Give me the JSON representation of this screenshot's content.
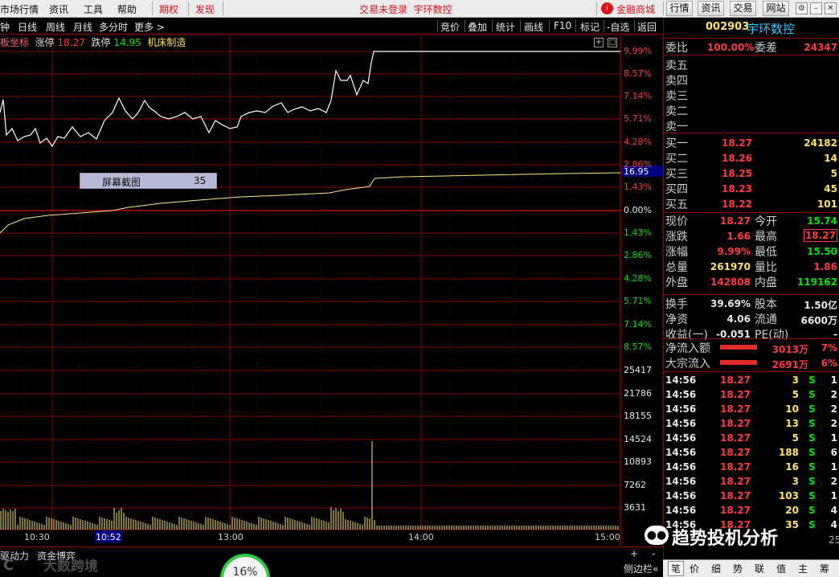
{
  "menubar": {
    "items": [
      "市场行情",
      "资讯",
      "工具",
      "帮助"
    ],
    "qiquan": "期权",
    "faxian": "发现",
    "status": "交易未登录",
    "stock_title": "宇环数控",
    "mall": "金融商城",
    "buttons": [
      "行情",
      "资讯",
      "交易",
      "网站"
    ]
  },
  "chart_toolbar": {
    "left": [
      "钟",
      "日线",
      "周线",
      "月线",
      "多分时",
      "更多"
    ],
    "more_arrow": ">",
    "right": [
      "竞价",
      "叠加",
      "统计",
      "画线",
      "F10",
      "标记",
      "-自选",
      "返回"
    ]
  },
  "info_line": {
    "label": "板坐标",
    "zt_label": "涨停",
    "zt_val": "18.27",
    "dt_label": "跌停",
    "dt_val": "14.95",
    "industry": "机床制造"
  },
  "price_axis": {
    "pct_labels_up": [
      "9.99%",
      "8.57%",
      "7.14%",
      "5.71%",
      "4.28%",
      "2.86%",
      "1.43%"
    ],
    "zero_label": "0.00%",
    "pct_labels_down": [
      "1.43%",
      "2.86%",
      "4.28%",
      "5.71%",
      "7.14%",
      "8.57%"
    ],
    "current_marker": "16.95",
    "vol_labels": [
      "25417",
      "21786",
      "18155",
      "14524",
      "10893",
      "7262",
      "3631"
    ]
  },
  "time_axis": {
    "labels": [
      "10:30",
      "13:00",
      "14:00",
      "15:00"
    ],
    "cursor": "10:52"
  },
  "popup": {
    "label": "屏幕截图",
    "value": "35"
  },
  "bottom_bar": {
    "tab1": "驱动力",
    "tab2": "资金博弈",
    "watermark": "大数跨境",
    "progress_text": "16%",
    "progress": 0.16,
    "plus": "+",
    "minus": "-",
    "side": "侧边栏",
    "side_arrow": "«"
  },
  "right_panel": {
    "code": "002903",
    "name": "宇环数控",
    "weibi_label": "委比",
    "weibi_val": "100.00%",
    "weicha_label": "委差",
    "weicha_val": "24347",
    "sell_labels": [
      "卖五",
      "卖四",
      "卖三",
      "卖二",
      "卖一"
    ],
    "buy_rows": [
      {
        "label": "买一",
        "price": "18.27",
        "vol": "24182"
      },
      {
        "label": "买二",
        "price": "18.26",
        "vol": "14"
      },
      {
        "label": "买三",
        "price": "18.25",
        "vol": "5"
      },
      {
        "label": "买四",
        "price": "18.23",
        "vol": "45"
      },
      {
        "label": "买五",
        "price": "18.22",
        "vol": "101"
      }
    ],
    "quote": [
      {
        "l1": "现价",
        "v1": "18.27",
        "c1": "red",
        "l2": "今开",
        "v2": "15.74",
        "c2": "green"
      },
      {
        "l1": "涨跌",
        "v1": "1.66",
        "c1": "red",
        "l2": "最高",
        "v2": "18.27",
        "c2": "red"
      },
      {
        "l1": "涨幅",
        "v1": "9.99%",
        "c1": "red",
        "l2": "最低",
        "v2": "15.50",
        "c2": "green"
      },
      {
        "l1": "总量",
        "v1": "261970",
        "c1": "yellow",
        "l2": "量比",
        "v2": "1.86",
        "c2": "red"
      },
      {
        "l1": "外盘",
        "v1": "142808",
        "c1": "red",
        "l2": "内盘",
        "v2": "119162",
        "c2": "green"
      }
    ],
    "fund": [
      {
        "l1": "换手",
        "v1": "39.69%",
        "l2": "股本",
        "v2": "1.50亿"
      },
      {
        "l1": "净资",
        "v1": "4.06",
        "l2": "流通",
        "v2": "6600万"
      },
      {
        "l1": "收益(一)",
        "v1": "-0.051",
        "l2": "PE(动)",
        "v2": "-"
      }
    ],
    "flow": [
      {
        "label": "净流入额",
        "val": "3013万",
        "pct": "7%"
      },
      {
        "label": "大宗流入",
        "val": "2691万",
        "pct": "6%"
      }
    ],
    "ticks": [
      {
        "time": "14:56",
        "price": "18.27",
        "vol": "3",
        "bs": "S",
        "extra": "1"
      },
      {
        "time": "14:56",
        "price": "18.27",
        "vol": "5",
        "bs": "S",
        "extra": "2"
      },
      {
        "time": "14:56",
        "price": "18.27",
        "vol": "10",
        "bs": "S",
        "extra": "2"
      },
      {
        "time": "14:56",
        "price": "18.27",
        "vol": "13",
        "bs": "S",
        "extra": "2"
      },
      {
        "time": "14:56",
        "price": "18.27",
        "vol": "5",
        "bs": "S",
        "extra": "1"
      },
      {
        "time": "14:56",
        "price": "18.27",
        "vol": "188",
        "bs": "S",
        "extra": "6"
      },
      {
        "time": "14:56",
        "price": "18.27",
        "vol": "16",
        "bs": "S",
        "extra": "1"
      },
      {
        "time": "14:56",
        "price": "18.27",
        "vol": "3",
        "bs": "S",
        "extra": "2"
      },
      {
        "time": "14:56",
        "price": "18.27",
        "vol": "103",
        "bs": "S",
        "extra": "1"
      },
      {
        "time": "14:56",
        "price": "18.27",
        "vol": "20",
        "bs": "S",
        "extra": "4"
      },
      {
        "time": "14:56",
        "price": "18.27",
        "vol": "35",
        "bs": "S",
        "extra": "4"
      }
    ],
    "last_tick_extra": "25",
    "watermark": "趋势投机分析",
    "bottom_tabs": [
      "笔",
      "价",
      "细",
      "势",
      "联",
      "值",
      "主",
      "筹"
    ]
  },
  "colors": {
    "up": "#ff3c3c",
    "down": "#00e400",
    "grid": "#8a0000",
    "avg_line": "#ffe97a"
  }
}
